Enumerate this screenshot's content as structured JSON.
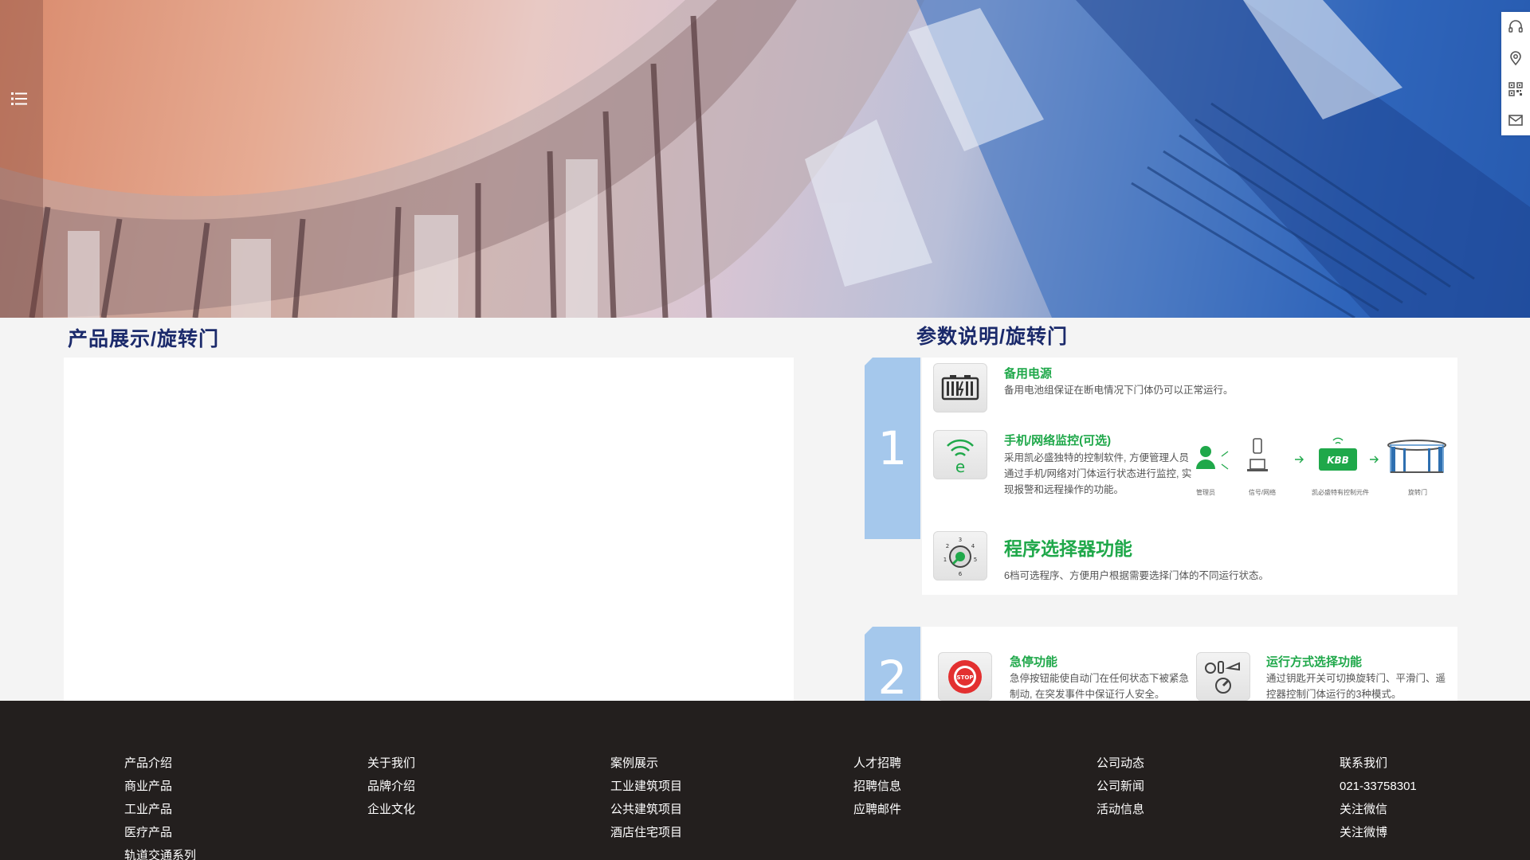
{
  "page": {
    "accent_color": "#1b2a6b",
    "green_color": "#1fa84a",
    "badge_color": "#a5c8ec",
    "footer_bg": "#231f1e"
  },
  "hero": {
    "menu_icon": "list-menu-icon",
    "image": "curved-glass-building-photo"
  },
  "float_toolbar": {
    "icons": [
      "headset-icon",
      "location-pin-icon",
      "qr-code-icon",
      "mail-icon"
    ]
  },
  "product": {
    "title": "产品展示/旋转门"
  },
  "params": {
    "title": "参数说明/旋转门",
    "card1": {
      "number": "1",
      "features": [
        {
          "icon": "battery-icon",
          "title": "备用电源",
          "desc": "备用电池组保证在断电情况下门体仍可以正常运行。"
        },
        {
          "icon": "wifi-e-icon",
          "title": "手机/网络监控(可选)",
          "desc": "采用凯必盛独特的控制软件, 方便管理人员通过手机/网络对门体运行状态进行监控, 实现报警和远程操作的功能。"
        },
        {
          "icon": "dial-selector-icon",
          "title": "程序选择器功能",
          "desc": "6档可选程序、方便用户根据需要选择门体的不同运行状态。"
        }
      ],
      "diagram": {
        "labels": [
          "管理员",
          "信号/网络",
          "凯必盛特有控制元件",
          "旋转门"
        ],
        "logo_text": "KBB"
      }
    },
    "card2": {
      "number": "2",
      "features": [
        {
          "icon": "stop-button-icon",
          "title": "急停功能",
          "desc": "急停按钮能使自动门在任何状态下被紧急制动, 在突发事件中保证行人安全。"
        },
        {
          "icon": "mode-switch-icon",
          "title": "运行方式选择功能",
          "desc": "通过钥匙开关可切换旋转门、平滑门、遥控器控制门体运行的3种模式。"
        }
      ]
    }
  },
  "footer": {
    "columns": [
      {
        "items": [
          "产品介绍",
          "商业产品",
          "工业产品",
          "医疗产品",
          "轨道交通系列"
        ]
      },
      {
        "items": [
          "关于我们",
          "品牌介绍",
          "企业文化"
        ]
      },
      {
        "items": [
          "案例展示",
          "工业建筑项目",
          "公共建筑项目",
          "酒店住宅项目"
        ]
      },
      {
        "items": [
          "人才招聘",
          "招聘信息",
          "应聘邮件"
        ]
      },
      {
        "items": [
          "公司动态",
          "公司新闻",
          "活动信息"
        ]
      },
      {
        "items": [
          "联系我们",
          "021-33758301",
          "关注微信",
          "关注微博"
        ]
      }
    ]
  }
}
